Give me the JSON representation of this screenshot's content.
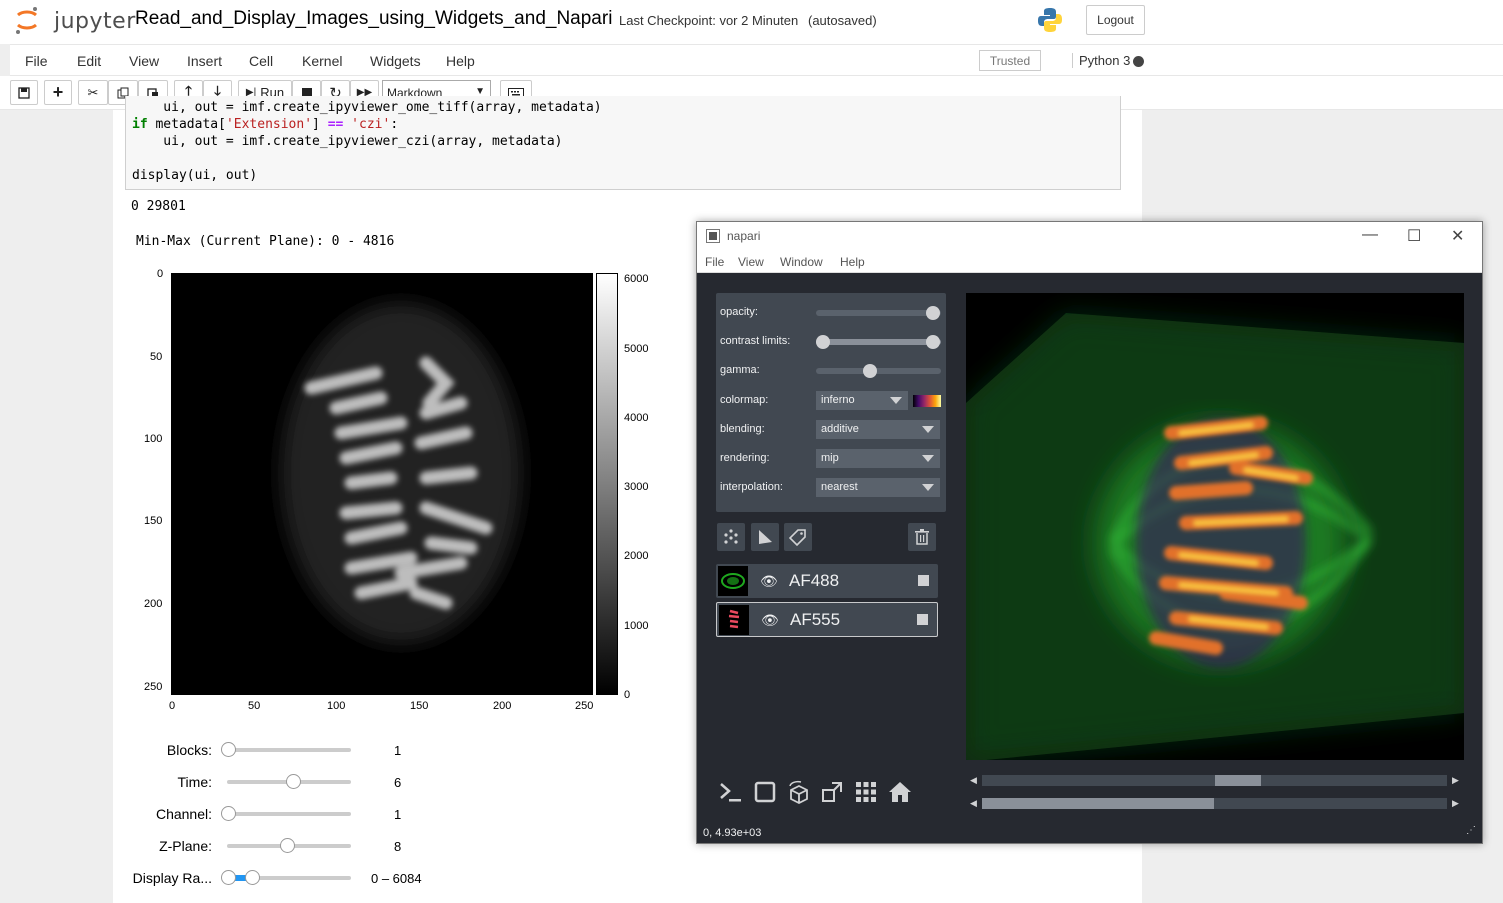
{
  "jupyter": {
    "logo_text": "jupyter",
    "notebook_name": "Read_and_Display_Images_using_Widgets_and_Napari",
    "checkpoint": "Last Checkpoint: vor 2 Minuten",
    "autosaved": "(autosaved)",
    "logout": "Logout",
    "menu": [
      "File",
      "Edit",
      "View",
      "Insert",
      "Cell",
      "Kernel",
      "Widgets",
      "Help"
    ],
    "trusted": "Trusted",
    "kernel": "Python 3",
    "toolbar": {
      "run_label": "Run",
      "cell_type": "Markdown"
    }
  },
  "cell": {
    "line0": "    ui, out = imf.create_ipyviewer_ome_tiff(array, metadata)",
    "line1_kw": "if",
    "line1_a": " metadata[",
    "line1_str": "'Extension'",
    "line1_b": "] ",
    "line1_op": "==",
    "line1_c": " ",
    "line1_str2": "'czi'",
    "line1_d": ":",
    "line2": "    ui, out = imf.create_ipyviewer_czi(array, metadata)",
    "line4": "display(ui, out)"
  },
  "output": {
    "minmax_all": "0 29801",
    "minmax_plane": "Min-Max (Current Plane): 0 - 4816"
  },
  "plot": {
    "y_ticks": [
      "0",
      "50",
      "100",
      "150",
      "200",
      "250"
    ],
    "x_ticks": [
      "0",
      "50",
      "100",
      "150",
      "200",
      "250"
    ],
    "cbar_ticks": [
      "6000",
      "5000",
      "4000",
      "3000",
      "2000",
      "1000",
      "0"
    ]
  },
  "sliders": [
    {
      "label": "Blocks:",
      "value": "1",
      "fraction": 0.0
    },
    {
      "label": "Time:",
      "value": "6",
      "fraction": 0.55
    },
    {
      "label": "Channel:",
      "value": "1",
      "fraction": 0.0
    },
    {
      "label": "Z-Plane:",
      "value": "8",
      "fraction": 0.5
    },
    {
      "label": "Display Ra...",
      "value": "0 – 6084",
      "fraction": 0.2
    }
  ],
  "napari": {
    "title": "napari",
    "menu": [
      "File",
      "View",
      "Window",
      "Help"
    ],
    "props": {
      "opacity_label": "opacity:",
      "contrast_label": "contrast limits:",
      "gamma_label": "gamma:",
      "colormap_label": "colormap:",
      "colormap_value": "inferno",
      "blending_label": "blending:",
      "blending_value": "additive",
      "rendering_label": "rendering:",
      "rendering_value": "mip",
      "interpolation_label": "interpolation:",
      "interpolation_value": "nearest"
    },
    "layers": [
      {
        "name": "AF488",
        "selected": false
      },
      {
        "name": "AF555",
        "selected": true
      }
    ],
    "status": "0, 4.93e+03"
  },
  "colors": {
    "napari_bg": "#262930",
    "napari_panel": "#414851",
    "green_channel": "#1fa81f",
    "inferno_hot": "#f9b41b"
  }
}
